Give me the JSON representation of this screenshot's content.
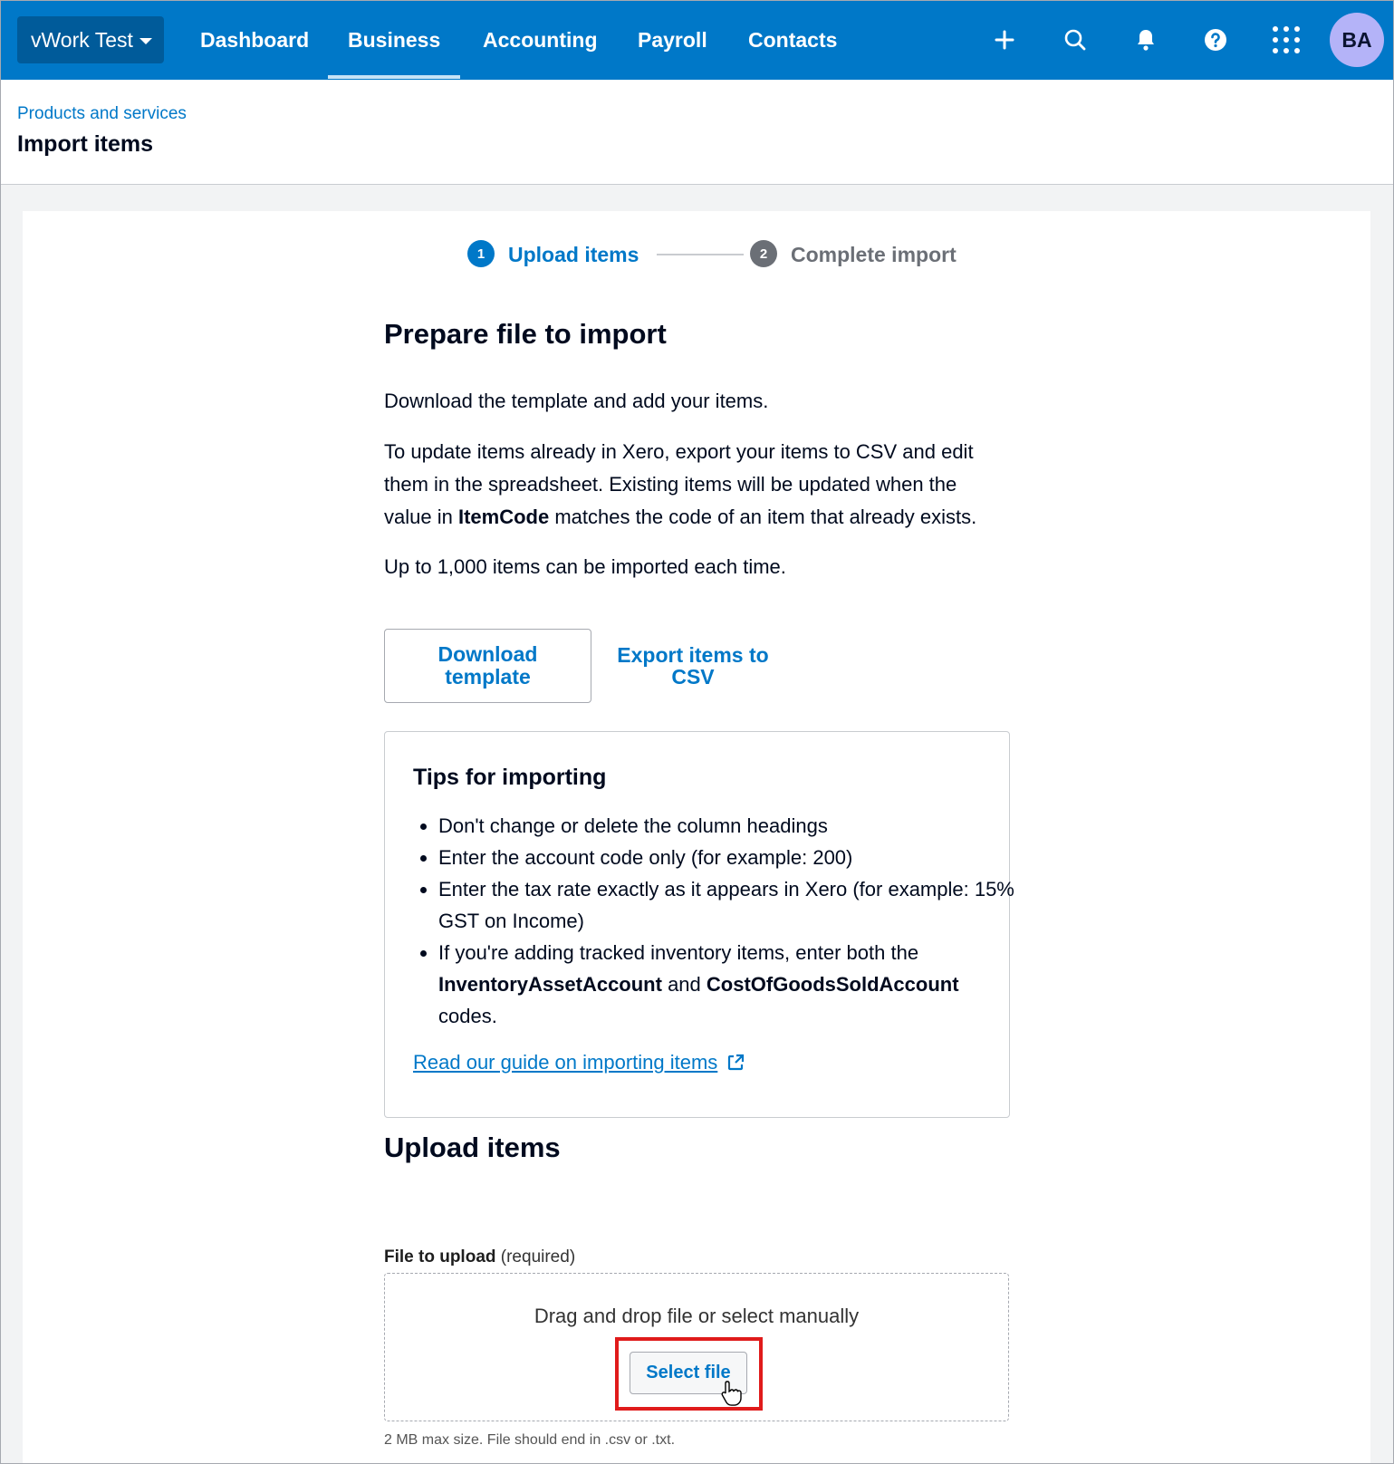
{
  "topnav": {
    "org_name": "vWork Test",
    "tabs": [
      {
        "label": "Dashboard",
        "active": false
      },
      {
        "label": "Business",
        "active": true
      },
      {
        "label": "Accounting",
        "active": false
      },
      {
        "label": "Payroll",
        "active": false
      },
      {
        "label": "Contacts",
        "active": false
      }
    ],
    "icons": [
      "plus-icon",
      "search-icon",
      "bell-icon",
      "help-icon",
      "apps-grid-icon"
    ],
    "avatar_initials": "BA",
    "colors": {
      "bar": "#0078c8",
      "org_switch": "#005b9a",
      "avatar": "#b4b3f8"
    }
  },
  "header": {
    "breadcrumb": "Products and services",
    "title": "Import items"
  },
  "stepper": {
    "steps": [
      {
        "number": "1",
        "label": "Upload items",
        "active": true
      },
      {
        "number": "2",
        "label": "Complete import",
        "active": false
      }
    ]
  },
  "prepare": {
    "heading": "Prepare file to import",
    "intro": "Download the template and add your items.",
    "update_text_before": "To update items already in Xero, export your items to CSV and edit them in the spreadsheet. Existing items will be updated when the value in ",
    "update_text_bold": "ItemCode",
    "update_text_after": " matches the code of an item that already exists.",
    "limit_text": "Up to 1,000 items can be imported each time.",
    "download_label": "Download template",
    "export_label": "Export items to CSV"
  },
  "tips": {
    "heading": "Tips for importing",
    "items": [
      "Don't change or delete the column headings",
      "Enter the account code only (for example: 200)",
      "Enter the tax rate exactly as it appears in Xero (for example: 15% GST on Income)"
    ],
    "inventory_before": "If you're adding tracked inventory items, enter both the ",
    "inventory_bold_1": "InventoryAssetAccount",
    "inventory_middle": " and ",
    "inventory_bold_2": "CostOfGoodsSoldAccount",
    "inventory_after": " codes.",
    "guide_link": "Read our guide on importing items"
  },
  "upload": {
    "heading": "Upload items",
    "field_label": "File to upload",
    "field_required": "(required)",
    "dropzone_text": "Drag and drop file or select manually",
    "select_button": "Select file",
    "hint": "2 MB max size. File should end in .csv or .txt.",
    "highlight_color": "#e01b1b"
  }
}
